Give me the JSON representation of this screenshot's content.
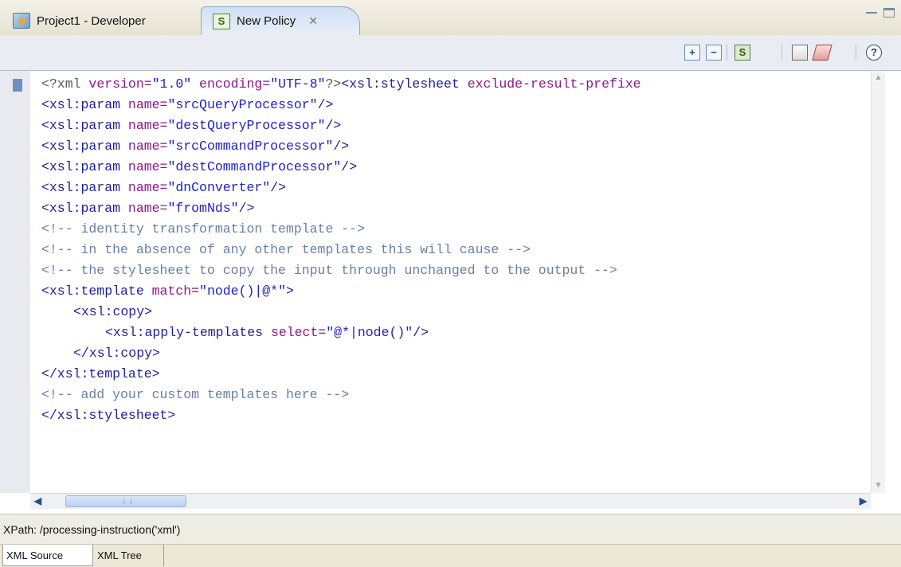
{
  "tabs": [
    {
      "label": "Project1 - Developer",
      "icon": "project-icon"
    },
    {
      "label": "New Policy",
      "icon": "policy-icon",
      "close": "✕"
    }
  ],
  "toolbar": {
    "expand": "+",
    "collapse": "−",
    "schema": "S",
    "help": "?"
  },
  "code": {
    "line1": {
      "p1": "<?xml",
      "p2": " version=",
      "p3": "\"1.0\"",
      "p4": " encoding=",
      "p5": "\"UTF-8\"",
      "p6": "?>",
      "p7": "<xsl:stylesheet",
      "p8": " exclude-result-prefixe"
    },
    "params": [
      {
        "tag": "<xsl:param",
        "attr": " name=",
        "val": "\"srcQueryProcessor\"",
        "end": "/>"
      },
      {
        "tag": "<xsl:param",
        "attr": " name=",
        "val": "\"destQueryProcessor\"",
        "end": "/>"
      },
      {
        "tag": "<xsl:param",
        "attr": " name=",
        "val": "\"srcCommandProcessor\"",
        "end": "/>"
      },
      {
        "tag": "<xsl:param",
        "attr": " name=",
        "val": "\"destCommandProcessor\"",
        "end": "/>"
      },
      {
        "tag": "<xsl:param",
        "attr": " name=",
        "val": "\"dnConverter\"",
        "end": "/>"
      },
      {
        "tag": "<xsl:param",
        "attr": " name=",
        "val": "\"fromNds\"",
        "end": "/>"
      }
    ],
    "comment1": "<!-- identity transformation template -->",
    "comment2": "<!-- in the absence of any other templates this will cause -->",
    "comment3": "<!-- the stylesheet to copy the input through unchanged to the output -->",
    "template_open": {
      "tag": "<xsl:template",
      "attr": " match=",
      "val": "\"node()|@*\"",
      "end": ">"
    },
    "copy_open": "<xsl:copy>",
    "apply": {
      "tag": "<xsl:apply-templates",
      "attr": " select=",
      "val": "\"@*|node()\"",
      "end": "/>"
    },
    "copy_close": "</xsl:copy>",
    "template_close": "</xsl:template>",
    "comment4": "<!-- add your custom templates here -->",
    "stylesheet_close": "</xsl:stylesheet>"
  },
  "status": {
    "xpath": "XPath: /processing-instruction('xml')"
  },
  "bottom_tabs": [
    "XML Source",
    "XML Tree"
  ]
}
